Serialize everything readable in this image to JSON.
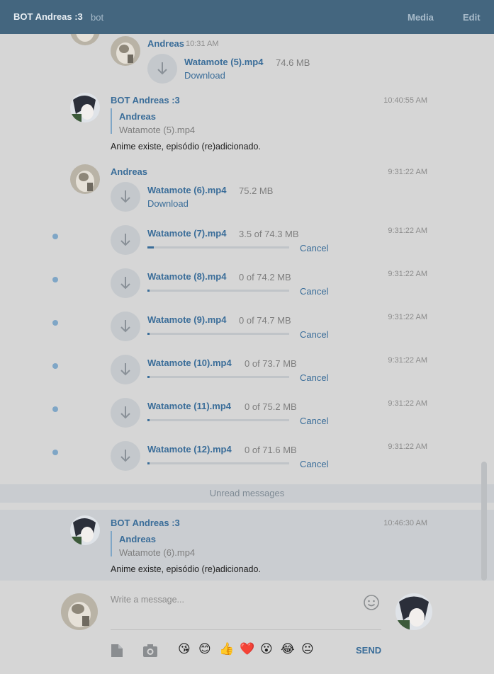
{
  "header": {
    "title": "BOT Andreas :3",
    "subtitle": "bot",
    "media_label": "Media",
    "edit_label": "Edit"
  },
  "messages": {
    "m1": {
      "name": "Andreas",
      "time": "10:31 AM",
      "file": "Watamote (5).mp4",
      "size": "74.6 MB",
      "action": "Download"
    },
    "m2": {
      "name": "BOT Andreas :3",
      "time": "10:40:55 AM",
      "reply_name": "Andreas",
      "reply_text": "Watamote (5).mp4",
      "text": "Anime existe, episódio (re)adicionado."
    },
    "m3": {
      "name": "Andreas",
      "time": "9:31:22 AM",
      "file": "Watamote (6).mp4",
      "size": "75.2 MB",
      "action": "Download"
    },
    "downloads": [
      {
        "file": "Watamote (7).mp4",
        "size": "3.5 of 74.3 MB",
        "time": "9:31:22 AM",
        "action": "Cancel",
        "progress": 0.047
      },
      {
        "file": "Watamote (8).mp4",
        "size": "0 of 74.2 MB",
        "time": "9:31:22 AM",
        "action": "Cancel",
        "progress": 0.0
      },
      {
        "file": "Watamote (9).mp4",
        "size": "0 of 74.7 MB",
        "time": "9:31:22 AM",
        "action": "Cancel",
        "progress": 0.0
      },
      {
        "file": "Watamote (10).mp4",
        "size": "0 of 73.7 MB",
        "time": "9:31:22 AM",
        "action": "Cancel",
        "progress": 0.0
      },
      {
        "file": "Watamote (11).mp4",
        "size": "0 of 75.2 MB",
        "time": "9:31:22 AM",
        "action": "Cancel",
        "progress": 0.0
      },
      {
        "file": "Watamote (12).mp4",
        "size": "0 of 71.6 MB",
        "time": "9:31:22 AM",
        "action": "Cancel",
        "progress": 0.0
      }
    ],
    "unread_label": "Unread messages",
    "m4": {
      "name": "BOT Andreas :3",
      "time": "10:46:30 AM",
      "reply_name": "Andreas",
      "reply_text": "Watamote (6).mp4",
      "text": "Anime existe, episódio (re)adicionado."
    }
  },
  "composer": {
    "placeholder": "Write a message...",
    "send_label": "SEND",
    "emojis": [
      "😘",
      "😊",
      "👍",
      "❤️",
      "😮",
      "😂",
      "😐"
    ]
  },
  "colors": {
    "header_bg": "#44667f",
    "accent": "#3a6d99",
    "unread_dot": "#7fa6c6"
  }
}
